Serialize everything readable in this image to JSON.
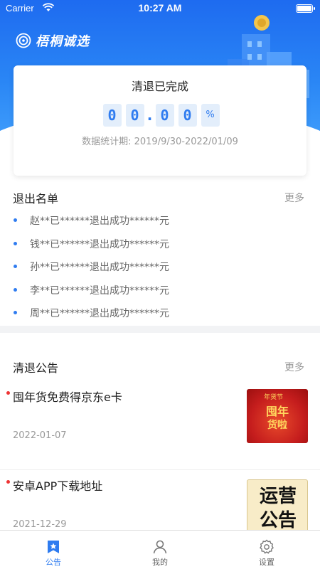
{
  "status_bar": {
    "carrier": "Carrier",
    "time": "10:27 AM"
  },
  "brand": {
    "name": "梧桐诚选"
  },
  "summary_card": {
    "title": "清退已完成",
    "digits": [
      "0",
      "0",
      "0",
      "0"
    ],
    "decimal_point": ".",
    "percent_sign": "%",
    "period_label": "数据统计期:  2019/9/30-2022/01/09"
  },
  "exit_section": {
    "title": "退出名单",
    "more": "更多",
    "items": [
      "赵**已******退出成功******元",
      "钱**已******退出成功******元",
      "孙**已******退出成功******元",
      "李**已******退出成功******元",
      "周**已******退出成功******元"
    ]
  },
  "notice_section": {
    "title": "清退公告",
    "more": "更多",
    "items": [
      {
        "title": "囤年货免费得京东e卡",
        "date": "2022-01-07",
        "thumb": {
          "tag": "年货节",
          "line1": "囤年",
          "line2": "货啦"
        }
      },
      {
        "title": "安卓APP下载地址",
        "date": "2021-12-29",
        "thumb": {
          "line1": "运营",
          "line2": "公告"
        }
      }
    ]
  },
  "tab_bar": {
    "tabs": [
      {
        "label": "公告",
        "icon": "star-bookmark-icon",
        "active": true
      },
      {
        "label": "我的",
        "icon": "person-icon",
        "active": false
      },
      {
        "label": "设置",
        "icon": "gear-icon",
        "active": false
      }
    ]
  },
  "colors": {
    "primary": "#2f7cf0",
    "header_blue": "#1e6bf0",
    "notice_dot": "#e33333"
  }
}
